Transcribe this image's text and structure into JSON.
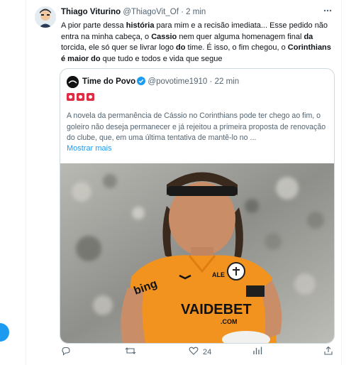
{
  "tweet": {
    "author_name": "Thiago Viturino",
    "author_handle": "@ThiagoVit_Of",
    "separator": "·",
    "time": "2 min",
    "text_segments": [
      {
        "t": "A pior parte dessa ",
        "b": false
      },
      {
        "t": "história",
        "b": true
      },
      {
        "t": " para mim e a recisão imediata... Esse pedido não entra na minha cabeça, o ",
        "b": false
      },
      {
        "t": "Cassio",
        "b": true
      },
      {
        "t": " nem quer alguma homenagem final ",
        "b": false
      },
      {
        "t": "da",
        "b": true
      },
      {
        "t": " torcida, ele só quer se livrar logo ",
        "b": false
      },
      {
        "t": "do",
        "b": true
      },
      {
        "t": " time. É isso, o fim chegou, o ",
        "b": false
      },
      {
        "t": "Corinthians",
        "b": true
      },
      {
        "t": " ",
        "b": false
      },
      {
        "t": "é maior do",
        "b": true
      },
      {
        "t": " que tudo e todos e vida que segue",
        "b": false
      }
    ]
  },
  "quote": {
    "author_name": "Time do Povo",
    "author_handle": "@povotime1910",
    "separator": "·",
    "time": "22 min",
    "text": "A novela da permanência de Cássio no Corinthians pode ter chego ao fim, o goleiro não deseja permanecer e já rejeitou a primeira proposta de renovação do clube, que, em uma última tentativa de mantê-lo no ...",
    "show_more": "Mostrar mais",
    "photo": {
      "sponsor_text": "VAIDEBET",
      "sponsor_sub": ".COM",
      "brand_text": "bing",
      "partner_text": "ALE"
    }
  },
  "actions": {
    "replies": "",
    "retweets": "",
    "likes": "24",
    "views": ""
  },
  "colors": {
    "accent": "#1d9bf0",
    "text": "#0f1419",
    "muted": "#536471",
    "jersey": "#f2931f"
  },
  "icons": [
    "more-icon",
    "verified-icon",
    "reply-icon",
    "retweet-icon",
    "like-icon",
    "views-icon"
  ]
}
